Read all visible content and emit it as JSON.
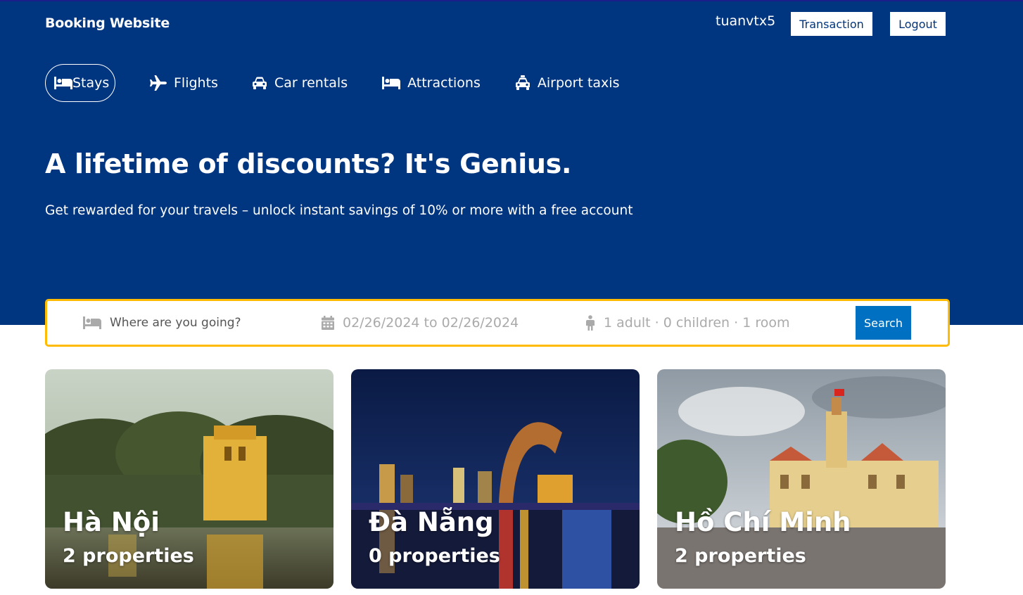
{
  "header": {
    "brand": "Booking Website",
    "username": "tuanvtx5",
    "transaction_label": "Transaction",
    "logout_label": "Logout"
  },
  "nav": {
    "items": [
      {
        "label": "Stays",
        "icon": "bed-icon",
        "active": true
      },
      {
        "label": "Flights",
        "icon": "plane-icon"
      },
      {
        "label": "Car rentals",
        "icon": "car-icon"
      },
      {
        "label": "Attractions",
        "icon": "bed-icon"
      },
      {
        "label": "Airport taxis",
        "icon": "taxi-icon"
      }
    ]
  },
  "hero": {
    "headline": "A lifetime of discounts? It's Genius.",
    "subline": "Get rewarded for your travels – unlock instant savings of 10% or more with a free account"
  },
  "search": {
    "destination_placeholder": "Where are you going?",
    "dates": "02/26/2024 to 02/26/2024",
    "options": "1 adult · 0 children · 1 room",
    "button_label": "Search"
  },
  "cities": [
    {
      "name": "Hà Nội",
      "properties": "2 properties"
    },
    {
      "name": "Đà Nẵng",
      "properties": "0 properties"
    },
    {
      "name": "Hồ Chí Minh",
      "properties": "2 properties"
    }
  ],
  "colors": {
    "hero_bg": "#003580",
    "search_border": "#febb02",
    "search_button": "#0071c2"
  }
}
